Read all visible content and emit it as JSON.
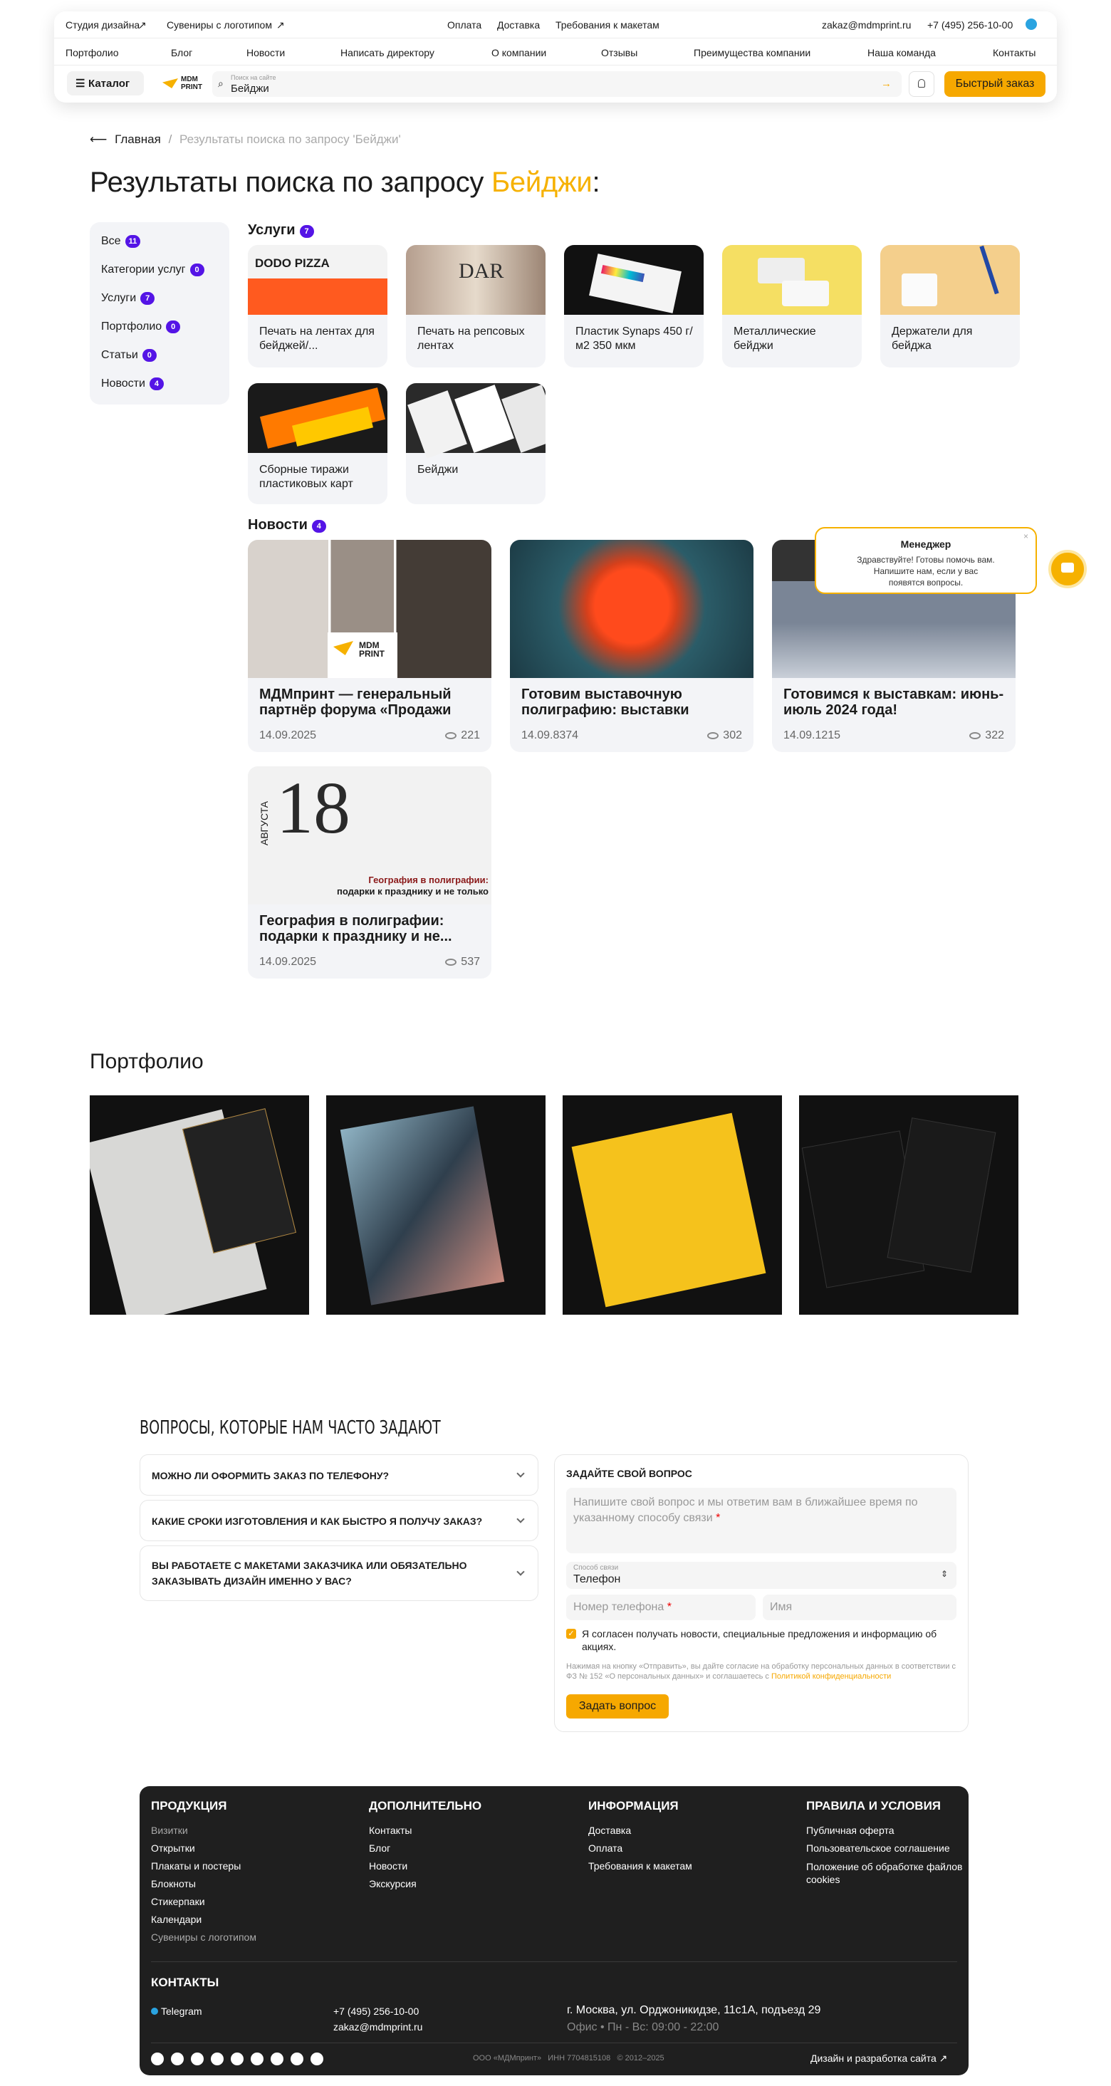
{
  "header": {
    "top_left": [
      "Студия дизайна",
      "Сувениры с логотипом"
    ],
    "top_center": [
      "Оплата",
      "Доставка",
      "Требования к макетам"
    ],
    "email": "zakaz@mdmprint.ru",
    "phone": "+7 (495) 256-10-00",
    "nav": [
      "Портфолио",
      "Блог",
      "Новости",
      "Написать директору",
      "О компании",
      "Отзывы",
      "Преимущества компании",
      "Наша команда",
      "Контакты"
    ],
    "catalog": "Каталог",
    "logo": "MDM PRINT",
    "search_hint": "Поиск на сайте",
    "search_value": "Бейджи",
    "quick_order": "Быстрый заказ"
  },
  "breadcrumb": {
    "home": "Главная",
    "current": "Результаты поиска по запросу 'Бейджи'"
  },
  "title": {
    "prefix": "Результаты поиска по запросу",
    "query": "Бейджи",
    "suffix": ":"
  },
  "sidebar": [
    {
      "label": "Все",
      "count": "11"
    },
    {
      "label": "Категории услуг",
      "count": "0"
    },
    {
      "label": "Услуги",
      "count": "7"
    },
    {
      "label": "Портфолио",
      "count": "0"
    },
    {
      "label": "Статьи",
      "count": "0"
    },
    {
      "label": "Новости",
      "count": "4"
    }
  ],
  "services": {
    "title": "Услуги",
    "count": "7",
    "items": [
      "Печать на лентах для бейджей/...",
      "Печать на репсовых лентах",
      "Пластик Synaps 450 г/м2 350 мкм",
      "Металлические бейджи",
      "Держатели для бейджа",
      "Сборные тиражи пластиковых карт",
      "Бейджи"
    ]
  },
  "news": {
    "title": "Новости",
    "count": "4",
    "items": [
      {
        "title": "МДМпринт — генеральный партнёр форума «Продажи по-...",
        "date": "14.09.2025",
        "views": "221"
      },
      {
        "title": "Готовим выставочную полиграфию: выставки августа...",
        "date": "14.09.8374",
        "views": "302"
      },
      {
        "title": "Готовимся к выставкам: июнь-июль 2024 года!",
        "date": "14.09.1215",
        "views": "322"
      },
      {
        "title": "География в полиграфии: подарки к празднику и не...",
        "date": "14.09.2025",
        "views": "537"
      }
    ]
  },
  "news_image_text": {
    "day": "18",
    "month": "АВГУСТА",
    "caption1": "География в полиграфии:",
    "caption2": "подарки к празднику и не только"
  },
  "chat": {
    "title": "Менеджер",
    "text": "Здравствуйте! Готовы помочь вам. Напишите нам, если у вас появятся вопросы."
  },
  "portfolio": {
    "title": "Портфолио"
  },
  "faq": {
    "title": "ВОПРОСЫ, КОТОРЫЕ НАМ ЧАСТО ЗАДАЮТ",
    "items": [
      "Можно ли оформить заказ по телефону?",
      "Какие сроки изготовления и как быстро я получу заказ?",
      "Вы работаете с макетами заказчика или обязательно заказывать дизайн именно у вас?"
    ]
  },
  "form": {
    "title": "ЗАДАЙТЕ СВОЙ ВОПРОС",
    "message_ph": "Напишите свой вопрос и мы ответим вам в ближайшее время по указанному способу связи",
    "method_label": "Способ связи",
    "method_value": "Телефон",
    "phone_ph": "Номер телефона",
    "name_ph": "Имя",
    "consent": "Я согласен получать новости, специальные предложения и информацию об акциях.",
    "legal": "Нажимая на кнопку «Отправить», вы дайте согласие на обработку персональных данных в соответствии с ФЗ № 152 «О персональных данных» и соглашаетесь с",
    "legal_link": "Политикой конфиденциальности",
    "submit": "Задать вопрос"
  },
  "footer": {
    "cols": [
      {
        "title": "ПРОДУКЦИЯ",
        "items": [
          "Визитки",
          "Открытки",
          "Плакаты и постеры",
          "Блокноты",
          "Стикерпаки",
          "Календари",
          "Сувениры с логотипом"
        ]
      },
      {
        "title": "ДОПОЛНИТЕЛЬНО",
        "items": [
          "Контакты",
          "Блог",
          "Новости",
          "Экскурсия"
        ]
      },
      {
        "title": "ИНФОРМАЦИЯ",
        "items": [
          "Доставка",
          "Оплата",
          "Требования к макетам"
        ]
      },
      {
        "title": "ПРАВИЛА И УСЛОВИЯ",
        "items": [
          "Публичная оферта",
          "Пользовательское соглашение",
          "Положение об обработке файлов cookies"
        ]
      }
    ],
    "contacts_title": "КОНТАКТЫ",
    "telegram": "Telegram",
    "phone": "+7 (495) 256-10-00",
    "email": "zakaz@mdmprint.ru",
    "address": "г. Москва, ул. Орджоникидзе, 11с1А, подъезд 29",
    "hours": "Офис • Пн - Вс: 09:00 - 22:00",
    "company": "ООО «МДМпринт»",
    "inn": "ИНН 7704815108",
    "years": "© 2012–2025",
    "dev": "Дизайн и разработка сайта"
  },
  "colors": {
    "accent": "#f6a800",
    "badge": "#5414e6",
    "footer": "#1f1f1f"
  }
}
